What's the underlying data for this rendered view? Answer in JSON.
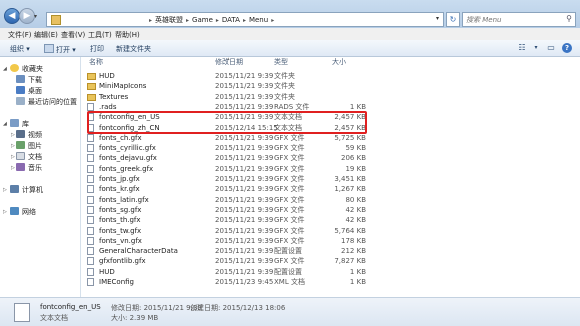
{
  "address": {
    "crumbs": [
      "英雄联盟",
      "Game",
      "DATA",
      "Menu"
    ]
  },
  "search": {
    "placeholder": "搜索 Menu"
  },
  "menu": [
    "文件(F)",
    "编辑(E)",
    "查看(V)",
    "工具(T)",
    "帮助(H)"
  ],
  "toolbar": {
    "organize": "组织 ▾",
    "open": "打开 ▾",
    "print": "打印",
    "new_folder": "新建文件夹"
  },
  "sidebar": {
    "favorites": "收藏夹",
    "downloads": "下载",
    "desktop": "桌面",
    "recent": "最近访问的位置",
    "libraries": "库",
    "videos": "视频",
    "pictures": "图片",
    "documents": "文档",
    "music": "音乐",
    "computer": "计算机",
    "network": "网络"
  },
  "columns": {
    "name": "名称",
    "date": "修改日期",
    "type": "类型",
    "size": "大小"
  },
  "files": [
    {
      "name": "HUD",
      "date": "2015/11/21 9:39",
      "type": "文件夹",
      "size": "",
      "kind": "folder"
    },
    {
      "name": "MiniMapIcons",
      "date": "2015/11/21 9:39",
      "type": "文件夹",
      "size": "",
      "kind": "folder"
    },
    {
      "name": "Textures",
      "date": "2015/11/21 9:39",
      "type": "文件夹",
      "size": "",
      "kind": "folder"
    },
    {
      "name": ".rads",
      "date": "2015/11/21 9:39",
      "type": "RADS 文件",
      "size": "1 KB",
      "kind": "doc"
    },
    {
      "name": "fontconfig_en_US",
      "date": "2015/11/21 9:39",
      "type": "文本文档",
      "size": "2,457 KB",
      "kind": "doc"
    },
    {
      "name": "fontconfig_zh_CN",
      "date": "2015/12/14 15:15",
      "type": "文本文档",
      "size": "2,457 KB",
      "kind": "doc"
    },
    {
      "name": "fonts_ch.gfx",
      "date": "2015/11/21 9:39",
      "type": "GFX 文件",
      "size": "5,725 KB",
      "kind": "doc"
    },
    {
      "name": "fonts_cyrillic.gfx",
      "date": "2015/11/21 9:39",
      "type": "GFX 文件",
      "size": "59 KB",
      "kind": "doc"
    },
    {
      "name": "fonts_dejavu.gfx",
      "date": "2015/11/21 9:39",
      "type": "GFX 文件",
      "size": "206 KB",
      "kind": "doc"
    },
    {
      "name": "fonts_greek.gfx",
      "date": "2015/11/21 9:39",
      "type": "GFX 文件",
      "size": "19 KB",
      "kind": "doc"
    },
    {
      "name": "fonts_jp.gfx",
      "date": "2015/11/21 9:39",
      "type": "GFX 文件",
      "size": "3,451 KB",
      "kind": "doc"
    },
    {
      "name": "fonts_kr.gfx",
      "date": "2015/11/21 9:39",
      "type": "GFX 文件",
      "size": "1,267 KB",
      "kind": "doc"
    },
    {
      "name": "fonts_latin.gfx",
      "date": "2015/11/21 9:39",
      "type": "GFX 文件",
      "size": "80 KB",
      "kind": "doc"
    },
    {
      "name": "fonts_sg.gfx",
      "date": "2015/11/21 9:39",
      "type": "GFX 文件",
      "size": "42 KB",
      "kind": "doc"
    },
    {
      "name": "fonts_th.gfx",
      "date": "2015/11/21 9:39",
      "type": "GFX 文件",
      "size": "42 KB",
      "kind": "doc"
    },
    {
      "name": "fonts_tw.gfx",
      "date": "2015/11/21 9:39",
      "type": "GFX 文件",
      "size": "5,764 KB",
      "kind": "doc"
    },
    {
      "name": "fonts_vn.gfx",
      "date": "2015/11/21 9:39",
      "type": "GFX 文件",
      "size": "178 KB",
      "kind": "doc"
    },
    {
      "name": "GeneralCharacterData",
      "date": "2015/11/21 9:39",
      "type": "配置设置",
      "size": "212 KB",
      "kind": "doc"
    },
    {
      "name": "gfxfontlib.gfx",
      "date": "2015/11/21 9:39",
      "type": "GFX 文件",
      "size": "7,827 KB",
      "kind": "doc"
    },
    {
      "name": "HUD",
      "date": "2015/11/21 9:39",
      "type": "配置设置",
      "size": "1 KB",
      "kind": "doc"
    },
    {
      "name": "IMEConfig",
      "date": "2015/11/23 9:45",
      "type": "XML 文档",
      "size": "1 KB",
      "kind": "doc"
    }
  ],
  "status": {
    "filename": "fontconfig_en_US",
    "modified": "修改日期: 2015/11/21 9:39",
    "created": "创建日期: 2015/12/13 18:06",
    "type": "文本文档",
    "size": "大小: 2.39 MB"
  }
}
